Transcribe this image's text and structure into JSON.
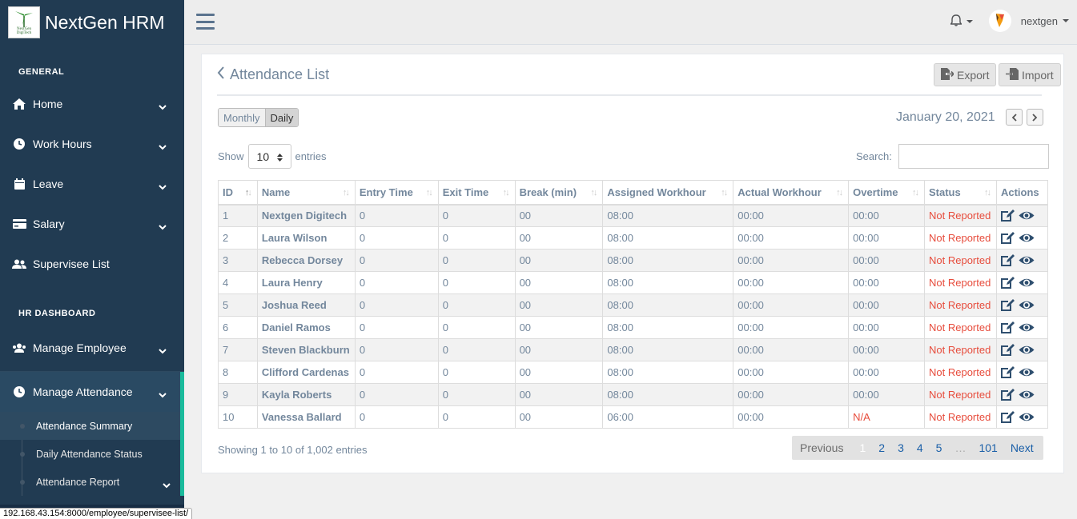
{
  "brand": {
    "name": "NextGen HRM",
    "logo_text_1": "NextGen",
    "logo_text_2": "DigiTech"
  },
  "sidebar": {
    "general_title": "GENERAL",
    "general_items": [
      {
        "label": "Home",
        "icon": "home-icon"
      },
      {
        "label": "Work Hours",
        "icon": "clock-icon"
      },
      {
        "label": "Leave",
        "icon": "calendar-icon"
      },
      {
        "label": "Salary",
        "icon": "credit-card-icon"
      },
      {
        "label": "Supervisee List",
        "icon": "users-icon"
      }
    ],
    "hr_title": "HR DASHBOARD",
    "hr_items": [
      {
        "label": "Manage Employee",
        "icon": "users-icon"
      },
      {
        "label": "Manage Attendance",
        "icon": "clock-icon"
      }
    ],
    "attendance_sub": [
      "Attendance Summary",
      "Daily Attendance Status",
      "Attendance Report"
    ]
  },
  "status_url": "192.168.43.154:8000/employee/supervisee-list/",
  "topbar": {
    "username": "nextgen"
  },
  "panel": {
    "title": "Attendance List",
    "export_label": "Export",
    "import_label": "Import",
    "toggle": [
      "Monthly",
      "Daily"
    ],
    "date": "January 20, 2021",
    "show_label": "Show",
    "entries_value": "10",
    "entries_label": "entries",
    "search_label": "Search:",
    "search_value": ""
  },
  "table": {
    "headers": [
      "ID",
      "Name",
      "Entry Time",
      "Exit Time",
      "Break (min)",
      "Assigned Workhour",
      "Actual Workhour",
      "Overtime",
      "Status",
      "Actions"
    ],
    "rows": [
      [
        "1",
        "Nextgen Digitech",
        "0",
        "0",
        "00",
        "08:00",
        "00:00",
        "00:00",
        "Not Reported"
      ],
      [
        "2",
        "Laura Wilson",
        "0",
        "0",
        "00",
        "08:00",
        "00:00",
        "00:00",
        "Not Reported"
      ],
      [
        "3",
        "Rebecca Dorsey",
        "0",
        "0",
        "00",
        "08:00",
        "00:00",
        "00:00",
        "Not Reported"
      ],
      [
        "4",
        "Laura Henry",
        "0",
        "0",
        "00",
        "08:00",
        "00:00",
        "00:00",
        "Not Reported"
      ],
      [
        "5",
        "Joshua Reed",
        "0",
        "0",
        "00",
        "08:00",
        "00:00",
        "00:00",
        "Not Reported"
      ],
      [
        "6",
        "Daniel Ramos",
        "0",
        "0",
        "00",
        "08:00",
        "00:00",
        "00:00",
        "Not Reported"
      ],
      [
        "7",
        "Steven Blackburn",
        "0",
        "0",
        "00",
        "08:00",
        "00:00",
        "00:00",
        "Not Reported"
      ],
      [
        "8",
        "Clifford Cardenas",
        "0",
        "0",
        "00",
        "08:00",
        "00:00",
        "00:00",
        "Not Reported"
      ],
      [
        "9",
        "Kayla Roberts",
        "0",
        "0",
        "00",
        "08:00",
        "00:00",
        "00:00",
        "Not Reported"
      ],
      [
        "10",
        "Vanessa Ballard",
        "0",
        "0",
        "00",
        "06:00",
        "00:00",
        "N/A",
        "Not Reported"
      ]
    ]
  },
  "footer": {
    "info": "Showing 1 to 10 of 1,002 entries",
    "pages": [
      "Previous",
      "1",
      "2",
      "3",
      "4",
      "5",
      "…",
      "101",
      "Next"
    ]
  },
  "colors": {
    "sidebar_bg": "#213b52",
    "accent": "#1abb9c",
    "status_red": "#e74c3c"
  }
}
